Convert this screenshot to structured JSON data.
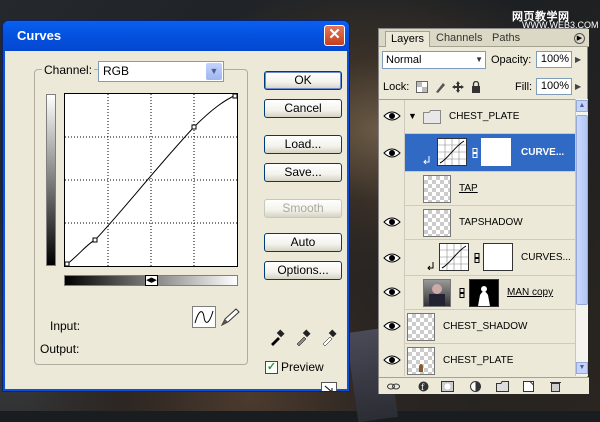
{
  "watermark": {
    "title": "网页教学网",
    "url": "WWW.WEB3.COM"
  },
  "curves_dialog": {
    "title": "Curves",
    "channel_label": "Channel:",
    "channel_value": "RGB",
    "input_label": "Input:",
    "output_label": "Output:",
    "buttons": {
      "ok": "OK",
      "cancel": "Cancel",
      "load": "Load...",
      "save": "Save...",
      "smooth": "Smooth",
      "auto": "Auto",
      "options": "Options..."
    },
    "preview_label": "Preview",
    "preview_checked": true
  },
  "layers_panel": {
    "tabs": [
      "Layers",
      "Channels",
      "Paths"
    ],
    "active_tab": "Layers",
    "blend_mode": "Normal",
    "opacity_label": "Opacity:",
    "opacity_value": "100%",
    "lock_label": "Lock:",
    "fill_label": "Fill:",
    "fill_value": "100%",
    "layers": [
      {
        "name": "CHEST_PLATE",
        "kind": "group",
        "selected": false
      },
      {
        "name": "CURVE...",
        "kind": "adjustment",
        "selected": true
      },
      {
        "name": "TAP",
        "kind": "pixel",
        "selected": false
      },
      {
        "name": "TAPSHADOW",
        "kind": "pixel",
        "selected": false
      },
      {
        "name": "CURVES...",
        "kind": "adjustment",
        "selected": false
      },
      {
        "name": "MAN copy",
        "kind": "masked",
        "selected": false
      },
      {
        "name": "CHEST_SHADOW",
        "kind": "pixel",
        "selected": false
      },
      {
        "name": "CHEST_PLATE",
        "kind": "pixel",
        "selected": false
      }
    ]
  },
  "colors": {
    "title_bar": "#0552e0",
    "selection": "#316ac5",
    "dialog_bg": "#ece9d8"
  }
}
